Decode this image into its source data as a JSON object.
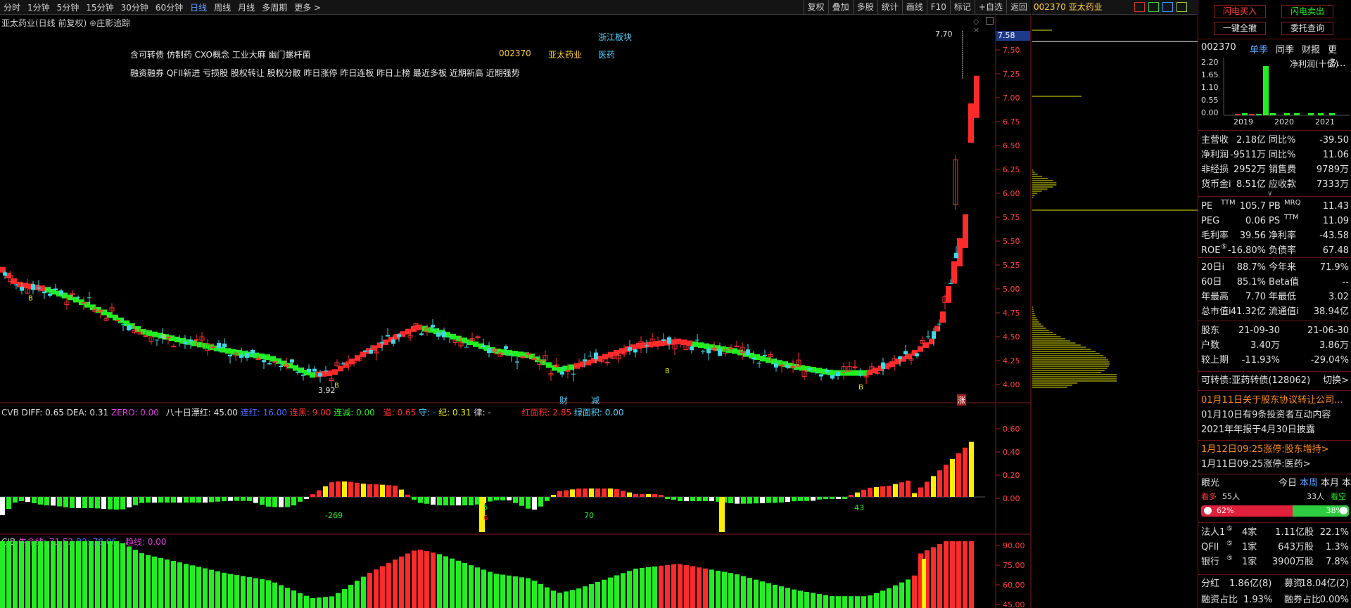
{
  "toolbar": {
    "periods": [
      "分时",
      "1分钟",
      "5分钟",
      "15分钟",
      "30分钟",
      "60分钟",
      "日线",
      "周线",
      "月线",
      "多周期",
      "更多 >"
    ],
    "tools": [
      "复权",
      "叠加",
      "多股",
      "统计",
      "画线",
      "F10",
      "标记",
      "+自选",
      "返回"
    ]
  },
  "stock": {
    "code": "002370",
    "name": "亚太药业"
  },
  "main": {
    "title": "亚太药业(日线 前复权)",
    "tracker": "庄影追踪",
    "tags_line1": "含可转债 仿制药 CXO概念 工业大麻 幽门螺杆菌",
    "sector": "浙江板块",
    "code": "002370",
    "name": "亚太药业",
    "industry": "医药",
    "tags_line2": "融资融券 QFII新进 亏损股 股权转让 股权分散 昨日涨停 昨日连板 昨日上榜 最近多板 近期新高 近期强势",
    "high_label": "7.70",
    "low_label": "3.92",
    "price_tag": "7.58",
    "cai": "财",
    "jian": "减",
    "zhang": "涨",
    "b": "B"
  },
  "yaxis_main": [
    "7.50",
    "7.25",
    "7.00",
    "6.75",
    "6.50",
    "6.25",
    "6.00",
    "5.75",
    "5.50",
    "5.25",
    "5.00",
    "4.75",
    "4.50",
    "4.25",
    "4.00"
  ],
  "cvb": {
    "name": "CVB",
    "diff_label": "DIFF: 0.65",
    "dea_label": "DEA: 0.31",
    "zero_label": "ZERO: 0.00",
    "bashi": "八十日漂红: 45.00",
    "lianhong": "连红: 16.00",
    "lianhei": "连黑: 9.00",
    "lianjian": "连减: 0.00",
    "dao": "道: 0.65",
    "shou": "守: -",
    "ji": "纪: 0.31",
    "lv": "律: -",
    "hongmianji": "红面积: 2.85",
    "lvmianji": "绿面积: 0.00",
    "labels": [
      "-269",
      "70",
      "43",
      "5",
      "6"
    ],
    "yaxis": [
      "0.60",
      "0.40",
      "0.20",
      "0.00"
    ]
  },
  "cjb": {
    "name": "CJB",
    "life": "生命线: 71.52",
    "b2": "B2: 78.06",
    "trend": "趋线: 0.00",
    "yaxis": [
      "90.00",
      "75.00",
      "60.00",
      "45.00"
    ]
  },
  "right": {
    "sell_btn": "闪电买入",
    "buy_btn": "闪电卖出",
    "one_btn": "一键全撤",
    "entrust_btn": "委托查询",
    "code": "002370",
    "tabs": [
      "单季",
      "同季",
      "财报",
      "更多..."
    ],
    "profit_title": "净利润(十亿)",
    "bar_y": [
      "2.20",
      "1.65",
      "1.10",
      "0.55",
      "0.00"
    ],
    "years": [
      "2019",
      "2020",
      "2021"
    ],
    "fin": [
      [
        "主营收",
        "2.18亿",
        "同比%",
        "-39.50"
      ],
      [
        "净利润",
        "-9511万",
        "同比%",
        "11.06"
      ],
      [
        "非经损",
        "2952万",
        "销售费",
        "9789万"
      ],
      [
        "货币金i",
        "8.51亿",
        "应收款",
        "7333万"
      ]
    ],
    "val": [
      [
        "PE",
        "TTM",
        "105.7",
        "PB",
        "MRQ",
        "11.43"
      ],
      [
        "PEG",
        "",
        "0.06",
        "PS",
        "TTM",
        "11.09"
      ],
      [
        "毛利率",
        "",
        "39.56",
        "净利率",
        "",
        "-43.58"
      ],
      [
        "ROE",
        "⑤",
        "-16.80%",
        "负债率",
        "",
        "67.48"
      ]
    ],
    "perf": [
      [
        "20日i",
        "88.7%",
        "今年来",
        "71.9%"
      ],
      [
        "60日",
        "85.1%",
        "Beta值",
        "--"
      ],
      [
        "年最高",
        "7.70",
        "年最低",
        "3.02"
      ],
      [
        "总市值i",
        "41.32亿",
        "流通值i",
        "38.94亿"
      ]
    ],
    "holders": [
      [
        "股东",
        "21-09-30",
        "21-06-30"
      ],
      [
        "户数",
        "3.40万",
        "3.86万"
      ],
      [
        "较上期",
        "-11.93%",
        "-29.04%"
      ]
    ],
    "bond": "可转债:亚药转债(128062)",
    "switch": "切换>",
    "news": [
      "01月11日关于股东协议转让公司...",
      "01月10日有9条投资者互动内容",
      "2021年年报于4月30日披露"
    ],
    "events": [
      "1月12日09:25涨停:股东增持>",
      "1月11日09:25涨停:医药>"
    ],
    "sentiment": {
      "title": "眼光",
      "tabs": [
        "今日",
        "本周",
        "本月",
        "本年"
      ],
      "bull_label": "看多",
      "bull_n": "55人",
      "bear_n": "33人",
      "bear_label": "看空",
      "bull_pct": "62%",
      "bear_pct": "38%",
      "bull": 0.62
    },
    "inst": [
      [
        "法人1",
        "⑤",
        "4家",
        "1.11亿股",
        "22.1%"
      ],
      [
        "QFII",
        "⑤",
        "1家",
        "643万股",
        "1.3%"
      ],
      [
        "银行",
        "⑤",
        "1家",
        "3900万股",
        "7.8%"
      ]
    ],
    "div": [
      "分红",
      "1.86亿(8)",
      "募资",
      "18.04亿(2)"
    ],
    "margin": [
      "融资占比",
      "1.93%",
      "融券占比",
      "0.00%"
    ]
  },
  "colors": {
    "up": "#ff2a2a",
    "down": "#3cd8e6",
    "green": "#22ee22",
    "yellow": "#e6e600",
    "axis": "#aa2020"
  }
}
